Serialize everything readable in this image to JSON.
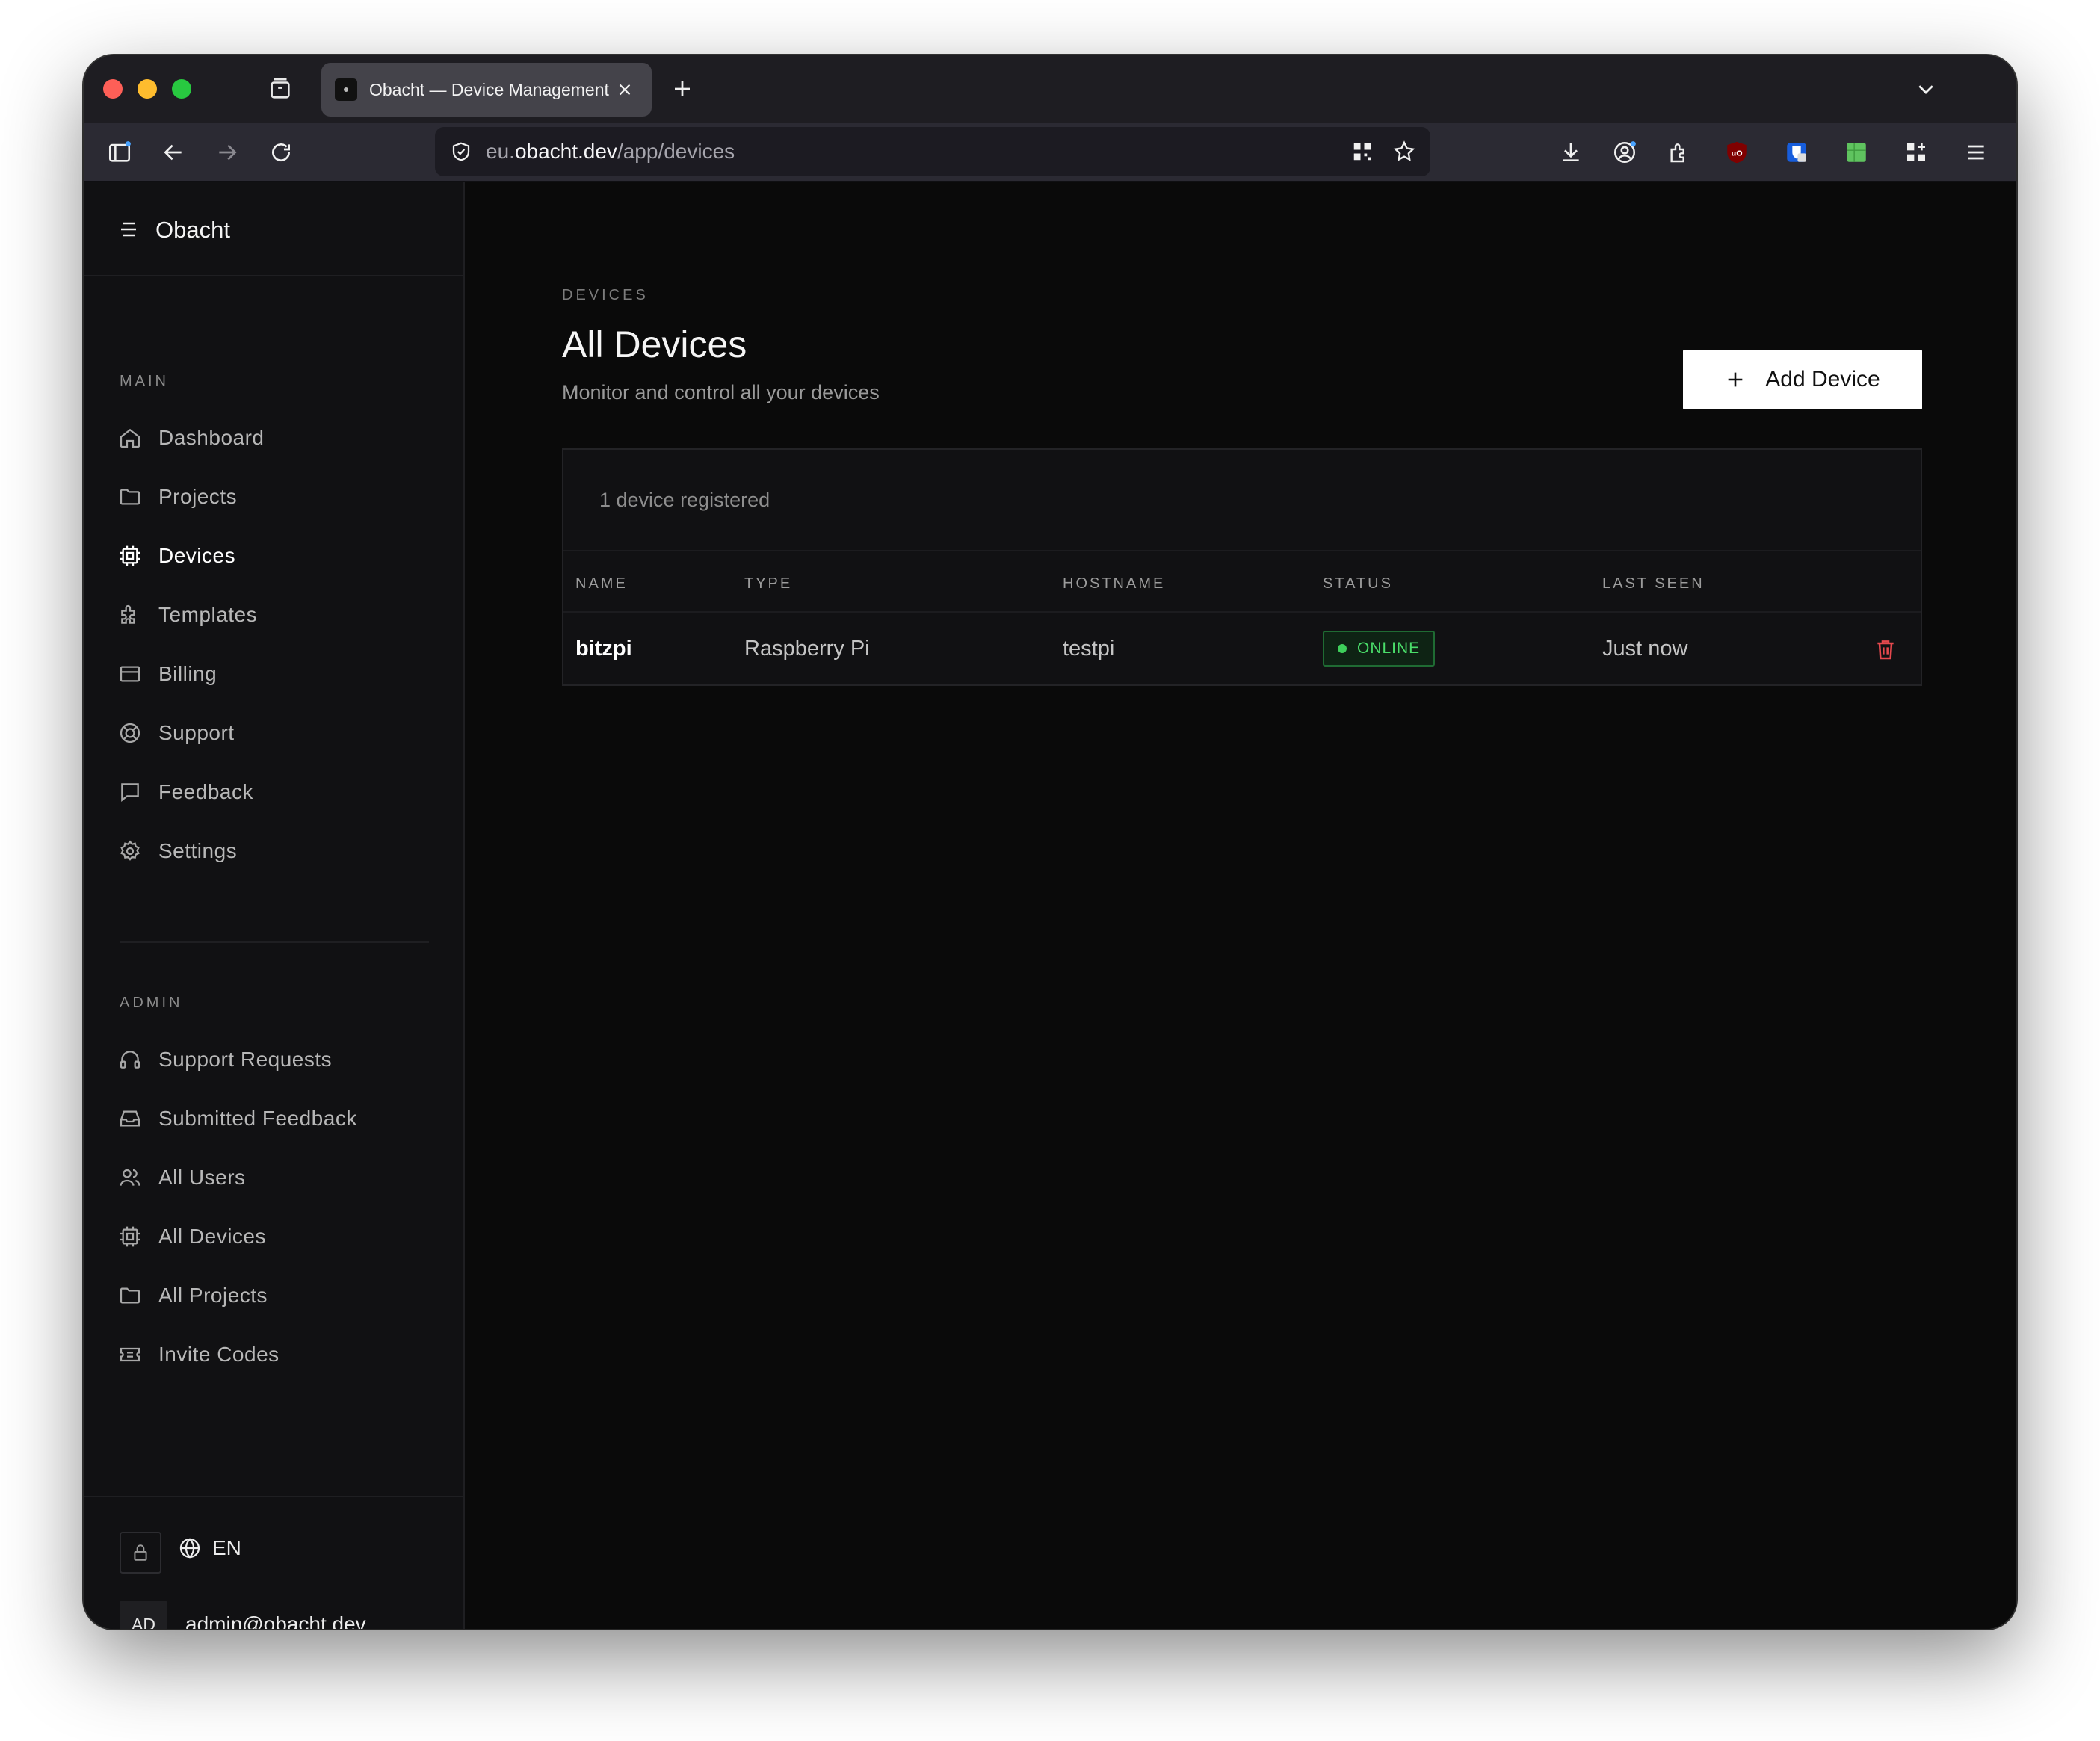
{
  "browser": {
    "tab_title": "Obacht — Device Management",
    "url_prefix": "eu.",
    "url_host": "obacht.dev",
    "url_path": "/app/devices"
  },
  "sidebar": {
    "brand": "Obacht",
    "main_label": "MAIN",
    "main_items": [
      {
        "label": "Dashboard",
        "icon": "home-icon"
      },
      {
        "label": "Projects",
        "icon": "folder-icon"
      },
      {
        "label": "Devices",
        "icon": "chip-icon",
        "active": true
      },
      {
        "label": "Templates",
        "icon": "puzzle-icon"
      },
      {
        "label": "Billing",
        "icon": "credit-card-icon"
      },
      {
        "label": "Support",
        "icon": "lifebuoy-icon"
      },
      {
        "label": "Feedback",
        "icon": "message-icon"
      },
      {
        "label": "Settings",
        "icon": "gear-icon"
      }
    ],
    "admin_label": "ADMIN",
    "admin_items": [
      {
        "label": "Support Requests",
        "icon": "headset-icon"
      },
      {
        "label": "Submitted Feedback",
        "icon": "inbox-icon"
      },
      {
        "label": "All Users",
        "icon": "users-icon"
      },
      {
        "label": "All Devices",
        "icon": "chip-icon"
      },
      {
        "label": "All Projects",
        "icon": "folder-icon"
      },
      {
        "label": "Invite Codes",
        "icon": "ticket-icon"
      }
    ],
    "language": "EN",
    "avatar_initials": "AD",
    "user_email": "admin@obacht.dev"
  },
  "page": {
    "eyebrow": "DEVICES",
    "title": "All Devices",
    "subtitle": "Monitor and control all your devices",
    "add_button": "Add Device",
    "count_text": "1 device registered",
    "columns": [
      "NAME",
      "TYPE",
      "HOSTNAME",
      "STATUS",
      "LAST SEEN"
    ],
    "rows": [
      {
        "name": "bitzpi",
        "type": "Raspberry Pi",
        "hostname": "testpi",
        "status": "ONLINE",
        "last_seen": "Just now"
      }
    ]
  },
  "colors": {
    "accent_online": "#4ade6a",
    "danger": "#e5484d",
    "background": "#0a0a0a"
  }
}
